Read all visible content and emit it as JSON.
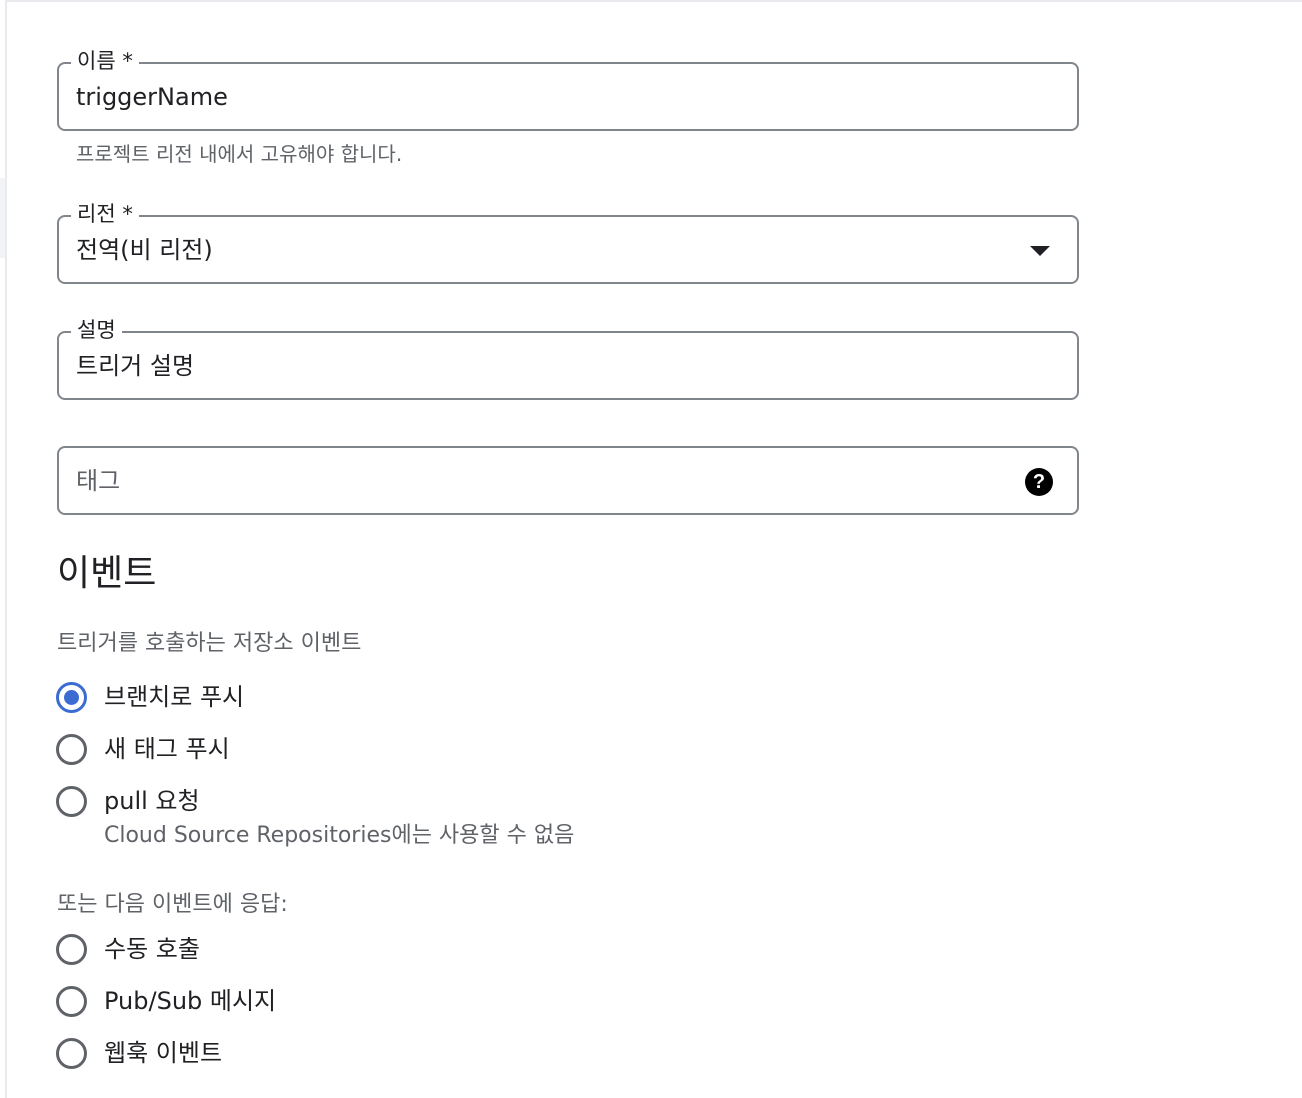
{
  "form": {
    "name": {
      "label": "이름 *",
      "value": "triggerName",
      "hint": "프로젝트 리전 내에서 고유해야 합니다."
    },
    "region": {
      "label": "리전 *",
      "value": "전역(비 리전)"
    },
    "description": {
      "label": "설명",
      "value": "트리거 설명"
    },
    "tags": {
      "placeholder": "태그",
      "help_icon": "help-icon",
      "help_glyph": "?"
    }
  },
  "events": {
    "title": "이벤트",
    "subtitle": "트리거를 호출하는 저장소 이벤트",
    "options": [
      {
        "label": "브랜치로 푸시",
        "checked": true
      },
      {
        "label": "새 태그 푸시",
        "checked": false
      },
      {
        "label": "pull 요청",
        "sublabel": "Cloud Source Repositories에는 사용할 수 없음",
        "checked": false
      }
    ],
    "other_subtitle": "또는 다음 이벤트에 응답:",
    "other_options": [
      {
        "label": "수동 호출",
        "checked": false
      },
      {
        "label": "Pub/Sub 메시지",
        "checked": false
      },
      {
        "label": "웹훅 이벤트",
        "checked": false
      }
    ]
  },
  "colors": {
    "accent": "#3c6bd1",
    "border": "#80868b",
    "text_secondary": "#5f6368"
  }
}
